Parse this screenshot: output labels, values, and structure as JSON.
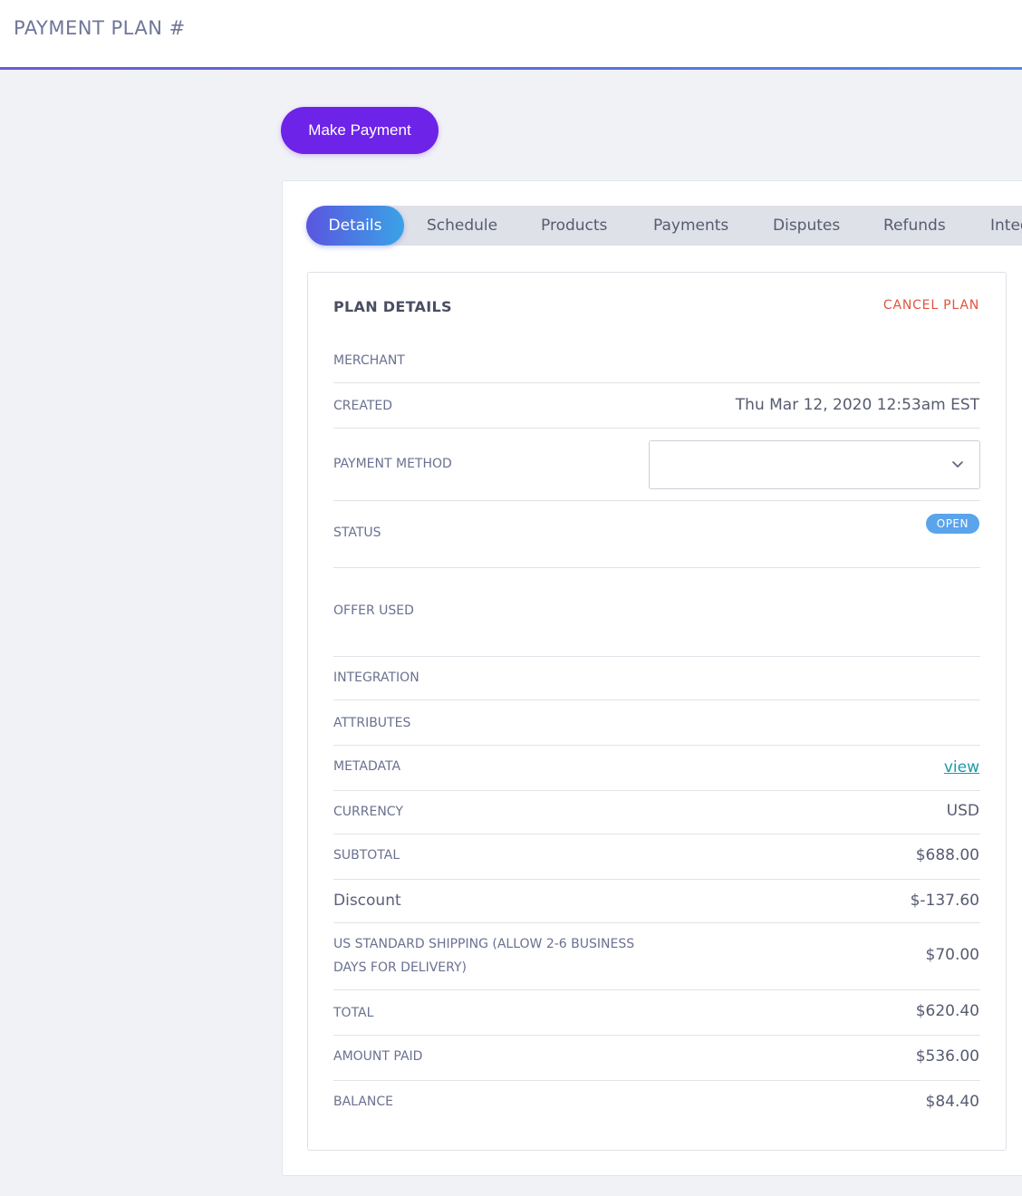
{
  "header": {
    "title": "PAYMENT PLAN #"
  },
  "actions": {
    "make_payment": "Make Payment"
  },
  "tabs": [
    {
      "label": "Details",
      "active": true
    },
    {
      "label": "Schedule"
    },
    {
      "label": "Products"
    },
    {
      "label": "Payments"
    },
    {
      "label": "Disputes"
    },
    {
      "label": "Refunds"
    },
    {
      "label": "Integ"
    }
  ],
  "plan": {
    "title": "PLAN DETAILS",
    "cancel_label": "CANCEL PLAN",
    "rows": {
      "merchant": {
        "label": "MERCHANT",
        "value": ""
      },
      "created": {
        "label": "CREATED",
        "value": "Thu Mar 12, 2020 12:53am EST"
      },
      "payment_method": {
        "label": "PAYMENT METHOD",
        "value": ""
      },
      "status": {
        "label": "STATUS",
        "value": "OPEN"
      },
      "offer_used": {
        "label": "OFFER USED",
        "value": ""
      },
      "integration": {
        "label": "INTEGRATION",
        "value": ""
      },
      "attributes": {
        "label": "ATTRIBUTES",
        "value": ""
      },
      "metadata": {
        "label": "METADATA",
        "value": "view"
      },
      "currency": {
        "label": "CURRENCY",
        "value": "USD"
      },
      "subtotal": {
        "label": "SUBTOTAL",
        "value": "$688.00"
      },
      "discount": {
        "label": "Discount",
        "value": "$-137.60"
      },
      "shipping": {
        "label": "US STANDARD SHIPPING (ALLOW 2-6 BUSINESS DAYS FOR DELIVERY)",
        "value": "$70.00"
      },
      "total": {
        "label": "TOTAL",
        "value": "$620.40"
      },
      "amount_paid": {
        "label": "AMOUNT PAID",
        "value": "$536.00"
      },
      "balance": {
        "label": "BALANCE",
        "value": "$84.40"
      }
    }
  },
  "colors": {
    "accent": "#6d23e8",
    "cancel": "#e0533d",
    "status_open": "#5aa4eb",
    "link": "#1a9aa8"
  },
  "icons": {
    "select_caret": "chevron-down-icon"
  }
}
